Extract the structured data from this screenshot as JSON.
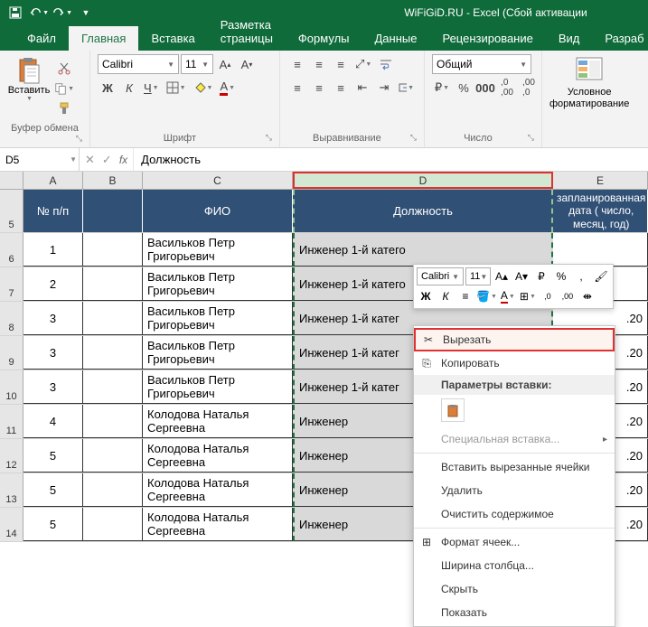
{
  "app": {
    "title": "WiFiGiD.RU - Excel (Сбой активации"
  },
  "tabs": {
    "file": "Файл",
    "home": "Главная",
    "insert": "Вставка",
    "layout": "Разметка страницы",
    "formulas": "Формулы",
    "data": "Данные",
    "review": "Рецензирование",
    "view": "Вид",
    "dev": "Разраб"
  },
  "ribbon": {
    "clipboard": {
      "label": "Буфер обмена",
      "paste": "Вставить"
    },
    "font": {
      "label": "Шрифт",
      "name": "Calibri",
      "size": "11"
    },
    "alignment": {
      "label": "Выравнивание"
    },
    "number": {
      "label": "Число",
      "format": "Общий"
    },
    "cond": {
      "label": "Условное\nформатирование"
    }
  },
  "formulaBar": {
    "nameBox": "D5",
    "value": "Должность"
  },
  "columns": {
    "A": "A",
    "B": "B",
    "C": "C",
    "D": "D",
    "E": "E"
  },
  "header": {
    "np": "№ п/п",
    "fio": "ФИО",
    "pos": "Должность",
    "date": "запланированная дата ( число, месяц, год)"
  },
  "rows": [
    {
      "rh": "6",
      "n": "1",
      "fio": "Васильков Петр Григорьевич",
      "pos": "Инженер 1-й катего",
      "e": ""
    },
    {
      "rh": "7",
      "n": "2",
      "fio": "Васильков Петр Григорьевич",
      "pos": "Инженер 1-й катего",
      "e": ""
    },
    {
      "rh": "8",
      "n": "3",
      "fio": "Васильков Петр Григорьевич",
      "pos": "Инженер 1-й катег",
      "e": ".20"
    },
    {
      "rh": "9",
      "n": "3",
      "fio": "Васильков Петр Григорьевич",
      "pos": "Инженер 1-й катег",
      "e": ".20"
    },
    {
      "rh": "10",
      "n": "3",
      "fio": "Васильков Петр Григорьевич",
      "pos": "Инженер 1-й катег",
      "e": ".20"
    },
    {
      "rh": "11",
      "n": "4",
      "fio": "Колодова Наталья Сергеевна",
      "pos": "Инженер",
      "e": ".20"
    },
    {
      "rh": "12",
      "n": "5",
      "fio": "Колодова Наталья Сергеевна",
      "pos": "Инженер",
      "e": ".20"
    },
    {
      "rh": "13",
      "n": "5",
      "fio": "Колодова Наталья Сергеевна",
      "pos": "Инженер",
      "e": ".20"
    },
    {
      "rh": "14",
      "n": "5",
      "fio": "Колодова Наталья Сергеевна",
      "pos": "Инженер",
      "e": ".20"
    }
  ],
  "miniToolbar": {
    "font": "Calibri",
    "size": "11"
  },
  "ctx": {
    "cut": "Вырезать",
    "copy": "Копировать",
    "pasteOpts": "Параметры вставки:",
    "pasteSpecial": "Специальная вставка...",
    "insertCut": "Вставить вырезанные ячейки",
    "delete": "Удалить",
    "clear": "Очистить содержимое",
    "format": "Формат ячеек...",
    "colWidth": "Ширина столбца...",
    "hide": "Скрыть",
    "show": "Показать"
  },
  "headerRowNum": "5"
}
